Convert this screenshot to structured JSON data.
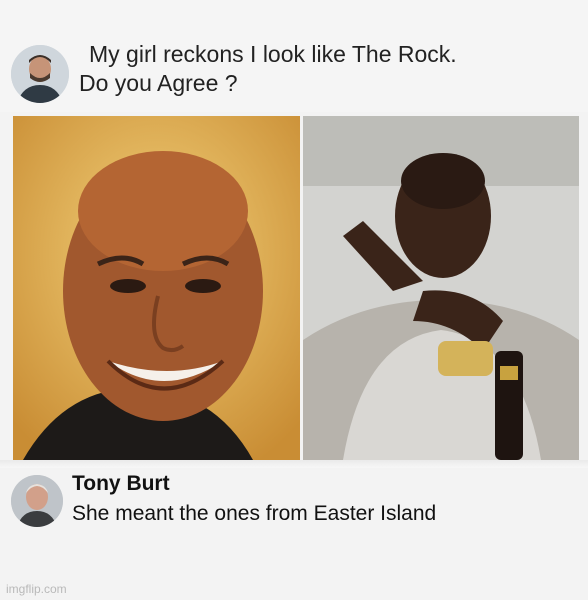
{
  "post": {
    "line1": "My girl reckons I look like The Rock.",
    "line2": "Do you Agree  ?"
  },
  "photos": {
    "left_alt": "photo-the-rock-smiling",
    "right_alt": "photo-man-pointing-gesture"
  },
  "comment": {
    "author": "Tony Burt",
    "text": "She meant the ones from Easter Island"
  },
  "watermark": "imgflip.com",
  "colors": {
    "left_photo_bg": "#e6b659",
    "right_photo_bg": "#cfcfcd",
    "text": "#222222"
  }
}
